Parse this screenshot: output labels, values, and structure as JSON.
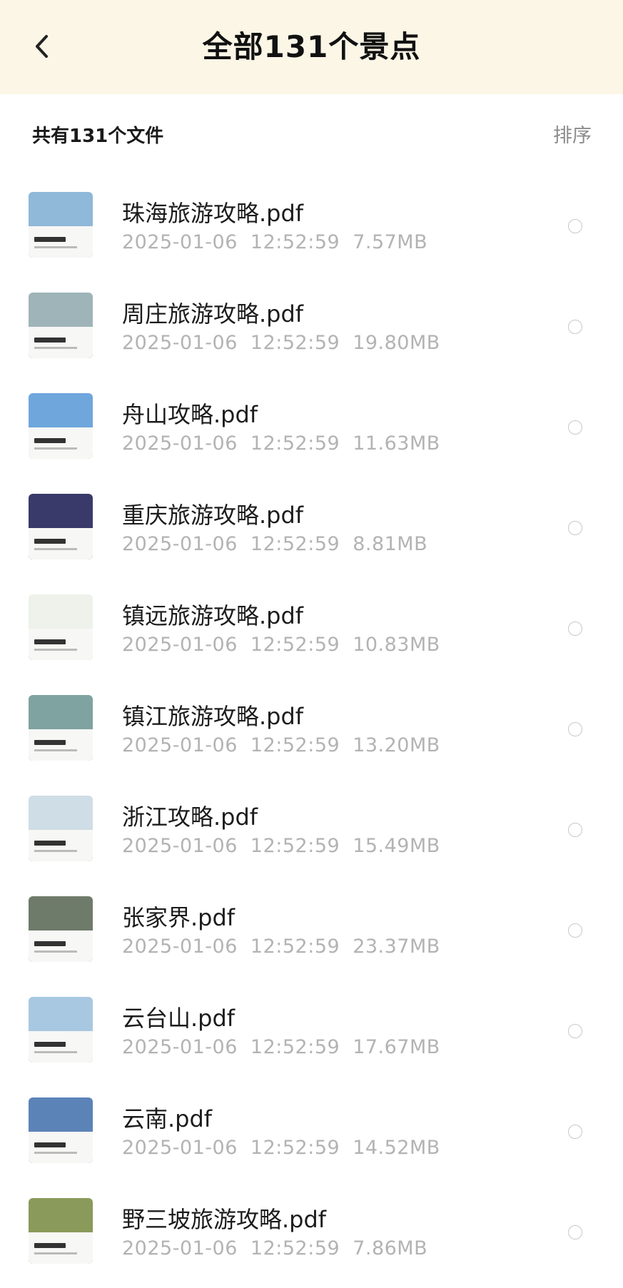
{
  "header": {
    "title": "全部131个景点",
    "back_icon": "chevron-left-icon",
    "background": "#fbf6e6"
  },
  "subheader": {
    "count_label": "共有131个文件",
    "sort_label": "排序"
  },
  "files": [
    {
      "name": "珠海旅游攻略.pdf",
      "date": "2025-01-06",
      "time": "12:52:59",
      "size": "7.57MB",
      "thumb_sky": "#8fb8d9",
      "thumb_land": "#5a7a94"
    },
    {
      "name": "周庄旅游攻略.pdf",
      "date": "2025-01-06",
      "time": "12:52:59",
      "size": "19.80MB",
      "thumb_sky": "#9fb4b8",
      "thumb_land": "#3d4f3e"
    },
    {
      "name": "舟山攻略.pdf",
      "date": "2025-01-06",
      "time": "12:52:59",
      "size": "11.63MB",
      "thumb_sky": "#6fa6dc",
      "thumb_land": "#c48f55"
    },
    {
      "name": "重庆旅游攻略.pdf",
      "date": "2025-01-06",
      "time": "12:52:59",
      "size": "8.81MB",
      "thumb_sky": "#3a3a6a",
      "thumb_land": "#1f2538"
    },
    {
      "name": "镇远旅游攻略.pdf",
      "date": "2025-01-06",
      "time": "12:52:59",
      "size": "10.83MB",
      "thumb_sky": "#eef2ea",
      "thumb_land": "#4f7a45"
    },
    {
      "name": "镇江旅游攻略.pdf",
      "date": "2025-01-06",
      "time": "12:52:59",
      "size": "13.20MB",
      "thumb_sky": "#7fa3a0",
      "thumb_land": "#4b6b4a"
    },
    {
      "name": "浙江攻略.pdf",
      "date": "2025-01-06",
      "time": "12:52:59",
      "size": "15.49MB",
      "thumb_sky": "#cfdde6",
      "thumb_land": "#466b56"
    },
    {
      "name": "张家界.pdf",
      "date": "2025-01-06",
      "time": "12:52:59",
      "size": "23.37MB",
      "thumb_sky": "#6f7b6a",
      "thumb_land": "#3f4a3c"
    },
    {
      "name": "云台山.pdf",
      "date": "2025-01-06",
      "time": "12:52:59",
      "size": "17.67MB",
      "thumb_sky": "#a8c8e2",
      "thumb_land": "#5b6b4f"
    },
    {
      "name": "云南.pdf",
      "date": "2025-01-06",
      "time": "12:52:59",
      "size": "14.52MB",
      "thumb_sky": "#5b83b8",
      "thumb_land": "#3e5a6e"
    },
    {
      "name": "野三坡旅游攻略.pdf",
      "date": "2025-01-06",
      "time": "12:52:59",
      "size": "7.86MB",
      "thumb_sky": "#8a9a5a",
      "thumb_land": "#6b7a3a"
    }
  ]
}
